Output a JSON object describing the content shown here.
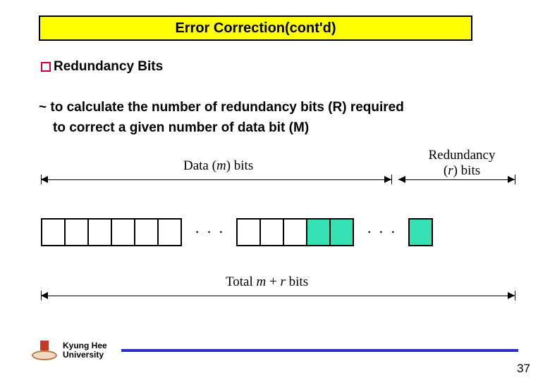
{
  "title": "Error Correction(cont'd)",
  "bullet": "Redundancy Bits",
  "body_line1": "~ to calculate the number of redundancy bits (R) required",
  "body_line2": "to correct a given number of data bit (M)",
  "diagram": {
    "data_label_prefix": "Data (",
    "data_label_var": "m",
    "data_label_suffix": ") bits",
    "red_label_line1": "Redundancy",
    "red_label_prefix": "(",
    "red_label_var": "r",
    "red_label_suffix": ") bits",
    "total_prefix": "Total ",
    "total_m": "m",
    "total_plus": " + ",
    "total_r": "r",
    "total_suffix": " bits",
    "dots": "· · ·"
  },
  "footer": {
    "uni1": "Kyung Hee",
    "uni2": "University",
    "page": "37"
  }
}
